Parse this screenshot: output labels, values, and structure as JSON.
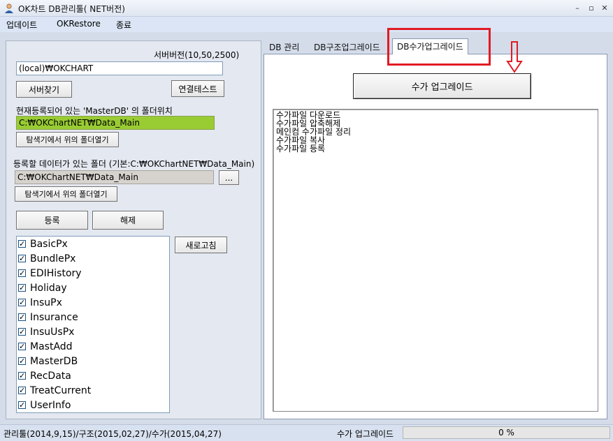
{
  "window": {
    "title": "OK차트 DB관리툴( NET버전)",
    "controls": {
      "minimize": "–",
      "restore": "▫",
      "close": "✕"
    }
  },
  "menu": {
    "items": [
      "업데이트",
      "OKRestore",
      "종료"
    ]
  },
  "left": {
    "server_version_label": "서버버전(10,50,2500)",
    "server_value": "(local)₩OKCHART",
    "find_server_button": "서버찾기",
    "connection_test_button": "연결테스트",
    "masterdb_label": "현재등록되어 있는 'MasterDB' 의 폴더위치",
    "masterdb_path": "C:₩OKChartNET₩Data_Main",
    "open_folder_button_1": "탐색기에서 위의 폴더열기",
    "data_folder_label": "등록할 데이터가 있는 폴더 (기본:C:₩OKChartNET₩Data_Main)",
    "data_folder_path": "C:₩OKChartNET₩Data_Main",
    "browse_button": "...",
    "open_folder_button_2": "탐색기에서 위의 폴더열기",
    "register_button": "등록",
    "unregister_button": "해제",
    "refresh_button": "새로고침",
    "check_mark": "✓",
    "tables": [
      "BasicPx",
      "BundlePx",
      "EDIHistory",
      "Holiday",
      "InsuPx",
      "Insurance",
      "InsuUsPx",
      "MastAdd",
      "MasterDB",
      "RecData",
      "TreatCurrent",
      "UserInfo"
    ]
  },
  "tabs": [
    {
      "label": "DB 관리"
    },
    {
      "label": "DB구조업그레이드"
    },
    {
      "label": "DB수가업그레이드"
    }
  ],
  "right": {
    "upgrade_button": "수가 업그레이드",
    "steps": [
      "수가파일 다운로드",
      "수가파일 압축해제",
      "메인컴 수가파일 정리",
      "수가파일 복사",
      "수가파일 등록"
    ]
  },
  "status": {
    "versions": "관리툴(2014,9,15)/구조(2015,02,27)/수가(2015,04,27)",
    "task": "수가 업그레이드",
    "progress_text": "0 %",
    "progress_value": 0
  },
  "colors": {
    "highlight": "#e01b24",
    "masterdb_path_bg": "#99cc33",
    "data_path_bg": "#d6d3ce"
  }
}
